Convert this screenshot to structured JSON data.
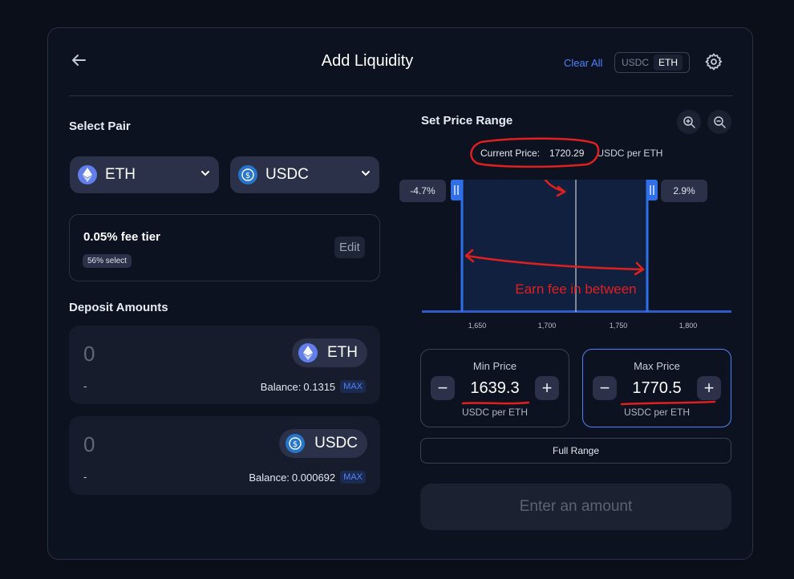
{
  "header": {
    "title": "Add Liquidity",
    "clear_all": "Clear All",
    "toggle_options": [
      "USDC",
      "ETH"
    ],
    "toggle_selected": "ETH"
  },
  "select_pair": {
    "label": "Select Pair",
    "token_a": "ETH",
    "token_b": "USDC"
  },
  "fee": {
    "tier": "0.05% fee tier",
    "badge": "56% select",
    "edit": "Edit"
  },
  "deposit": {
    "label": "Deposit Amounts",
    "items": [
      {
        "value": "0",
        "token": "ETH",
        "usd": "-",
        "balance_label": "Balance:",
        "balance": "0.1315",
        "max": "MAX"
      },
      {
        "value": "0",
        "token": "USDC",
        "usd": "-",
        "balance_label": "Balance:",
        "balance": "0.000692",
        "max": "MAX"
      }
    ]
  },
  "range": {
    "label": "Set Price Range",
    "current_price_label": "Current Price:",
    "current_price": "1720.29",
    "current_price_unit": "USDC per ETH",
    "lower_pct": "-4.7%",
    "upper_pct": "2.9%",
    "annotation": "Earn fee in between",
    "x_ticks": [
      "1,650",
      "1,700",
      "1,750",
      "1,800"
    ],
    "min_price_label": "Min Price",
    "min_price": "1639.3",
    "max_price_label": "Max Price",
    "max_price": "1770.5",
    "price_unit": "USDC per ETH",
    "full_range": "Full Range"
  },
  "submit": {
    "label": "Enter an amount"
  },
  "colors": {
    "accent": "#4c82fb",
    "range_handle": "#2f6fe8",
    "annotation_red": "#e0201f",
    "eth": "#627eea",
    "usdc": "#2775ca"
  }
}
